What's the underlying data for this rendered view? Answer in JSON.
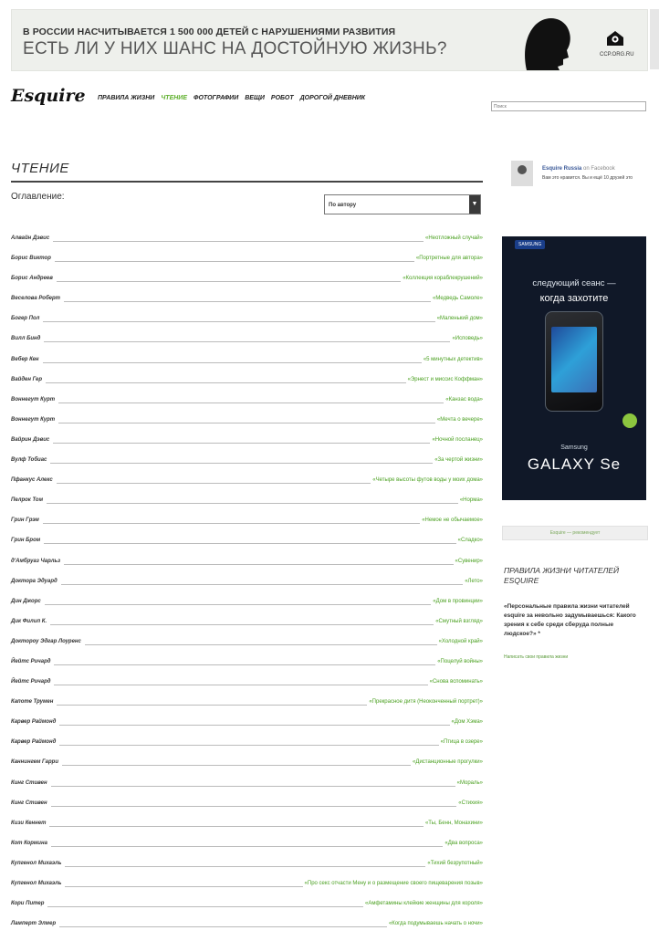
{
  "banner": {
    "line1": "В РОССИИ НАСЧИТЫВАЕТСЯ 1 500 000 ДЕТЕЙ С НАРУШЕНИЯМИ РАЗВИТИЯ",
    "line2": "ЕСТЬ ЛИ У НИХ ШАНС НА ДОСТОЙНУЮ ЖИЗНЬ?",
    "logo_text": "CCP.ORG.RU"
  },
  "header": {
    "brand": "Esquire",
    "nav": [
      {
        "label": "ПРАВИЛА ЖИЗНИ",
        "active": false
      },
      {
        "label": "ЧТЕНИЕ",
        "active": true
      },
      {
        "label": "ФОТОГРАФИИ",
        "active": false
      },
      {
        "label": "ВЕЩИ",
        "active": false
      },
      {
        "label": "РОБОТ",
        "active": false
      },
      {
        "label": "ДОРОГОЙ ДНЕВНИК",
        "active": false
      }
    ],
    "search_placeholder": "Поиск"
  },
  "main": {
    "title": "ЧТЕНИЕ",
    "toc_label": "Оглавление:",
    "sort_selected": "По автору",
    "rows": [
      {
        "author": "Алвайн Дэвис",
        "title": "«Неотложный случай»"
      },
      {
        "author": "Борис Виктор",
        "title": "«Портретные для автора»"
      },
      {
        "author": "Борис Андреев",
        "title": "«Коллекция кораблекрушений»"
      },
      {
        "author": "Веселова Роберт",
        "title": "«Медведь Самоле»"
      },
      {
        "author": "Богер Пол",
        "title": "«Маленький дом»"
      },
      {
        "author": "Вилл Бинд",
        "title": "«Исповедь»"
      },
      {
        "author": "Вебер Кен",
        "title": "«5 минутных детектив»"
      },
      {
        "author": "Вайден Гер",
        "title": "«Эрнест и миссис Коффман»"
      },
      {
        "author": "Воннегут Курт",
        "title": "«Канзас вода»"
      },
      {
        "author": "Воннегут Курт",
        "title": "«Мечта о вечере»"
      },
      {
        "author": "Вайрин Дэвис",
        "title": "«Ночной посланец»"
      },
      {
        "author": "Вулф Тобиас",
        "title": "«За чертой жизни»"
      },
      {
        "author": "Пфанкус Алекс",
        "title": "«Четыре высоты футов воды у моих дома»"
      },
      {
        "author": "Пелрок Том",
        "title": "«Норма»"
      },
      {
        "author": "Грин Грэм",
        "title": "«Немое не обычаемое»"
      },
      {
        "author": "Грин Бром",
        "title": "«Сладко»"
      },
      {
        "author": "д'Амбруаз Чарльз",
        "title": "«Сувенир»"
      },
      {
        "author": "Доктора Эдуард",
        "title": "«Лето»"
      },
      {
        "author": "Дин Джорс",
        "title": "«Дом в провинции»"
      },
      {
        "author": "Дик Филип К.",
        "title": "«Смутный взгляд»"
      },
      {
        "author": "Доктороу Эдгар Лоуренс",
        "title": "«Холодной край»"
      },
      {
        "author": "Йейтс Ричард",
        "title": "«Поцелуй войны»"
      },
      {
        "author": "Йейтс Ричард",
        "title": "«Снова вспоминать»"
      },
      {
        "author": "Капоте Трумен",
        "title": "«Прекрасное дитя (Неоконченный портрет)»"
      },
      {
        "author": "Карвер Раймонд",
        "title": "«Дом Хэма»"
      },
      {
        "author": "Карвер Раймонд",
        "title": "«Птица в озере»"
      },
      {
        "author": "Каннингем Гарри",
        "title": "«Дистанционные прогулки»"
      },
      {
        "author": "Кинг Стивен",
        "title": "«Мораль»"
      },
      {
        "author": "Кинг Стивен",
        "title": "«Стихия»"
      },
      {
        "author": "Кизи Кеннет",
        "title": "«Ты, Бенн, Монахини»"
      },
      {
        "author": "Кот Кормина",
        "title": "«Два вопроса»"
      },
      {
        "author": "Купгенол Михаэль",
        "title": "«Тихий безрупотный»"
      },
      {
        "author": "Купгенол Михаэль",
        "title": "«Про секс отчасти Мену и о размещение своего пищеварения позыв»"
      },
      {
        "author": "Кори Питер",
        "title": "«Амфетамины клейкие женщины для короля»"
      },
      {
        "author": "Ламперт Элмер",
        "title": "«Когда подумываешь начать о ночи»"
      }
    ]
  },
  "sidebar": {
    "fb": {
      "name": "Esquire Russia",
      "on_fb": "on Facebook",
      "desc": "Вам это нравится. Вы и ещё 10 друзей это"
    },
    "ad": {
      "brand": "SAMSUNG",
      "line1": "следующий сеанс —",
      "line2": "когда захотите",
      "model_brand": "Samsung",
      "model": "GALAXY Se"
    },
    "small_button": "Esquire — рекомендует",
    "rules_title": "ПРАВИЛА ЖИЗНИ ЧИТАТЕЛЕЙ ESQUIRE",
    "rules_text": "«Персональные правила жизни читателей esquire за невольно задумываешься: Какого зрения к себе среди сберуда полные людское?» *",
    "rules_link": "Написать свои правила жизни"
  }
}
